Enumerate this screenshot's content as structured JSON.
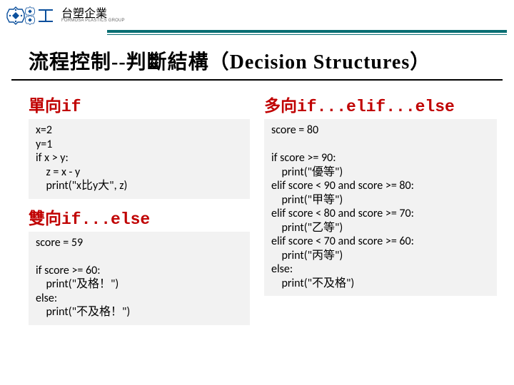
{
  "header": {
    "brand_cn": "台塑企業",
    "brand_en": "FORMOSA PLASTICS GROUP"
  },
  "title": "流程控制--判斷結構（Decision Structures）",
  "left": {
    "heading1": "單向if",
    "code1": "x=2\ny=1\nif x > y:\n    z = x - y\n    print(\"x比y大\", z)",
    "heading2": "雙向if...else",
    "code2": "score = 59\n\nif score >= 60:\n    print(\"及格！\")\nelse:\n    print(\"不及格！\")"
  },
  "right": {
    "heading1": "多向if...elif...else",
    "code1": "score = 80\n\nif score >= 90:\n    print(\"優等\")\nelif score < 90 and score >= 80:\n    print(\"甲等\")\nelif score < 80 and score >= 70:\n    print(\"乙等\")\nelif score < 70 and score >= 60:\n    print(\"丙等\")\nelse:\n    print(\"不及格\")"
  }
}
